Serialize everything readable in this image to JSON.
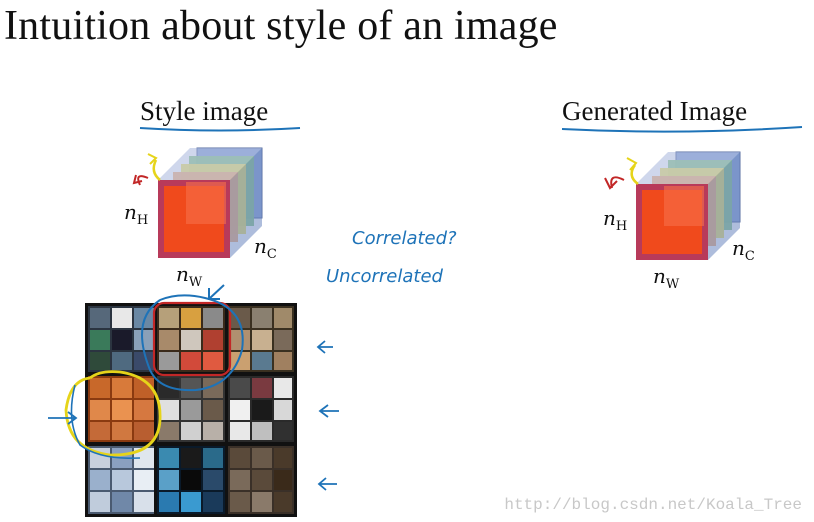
{
  "title": "Intuition about style of an image",
  "style_label": "Style image",
  "generated_label": "Generated Image",
  "dims": {
    "h_sym": "n",
    "h_sub": "H",
    "w_sym": "n",
    "w_sub": "W",
    "c_sym": "n",
    "c_sub": "C"
  },
  "annotations": {
    "correlated": "Correlated?",
    "uncorrelated": "Uncorrelated"
  },
  "watermark": "http://blog.csdn.net/Koala_Tree",
  "colors": {
    "cube_front": "#f04a1c",
    "cube_dark": "#b83a5a",
    "cube_yellow": "#e8d84a",
    "cube_green": "#8ec98a",
    "cube_blue": "#8ea7d8",
    "pen_blue": "#1e73b8",
    "pen_red": "#c22727",
    "pen_yellow": "#e6d41a"
  }
}
